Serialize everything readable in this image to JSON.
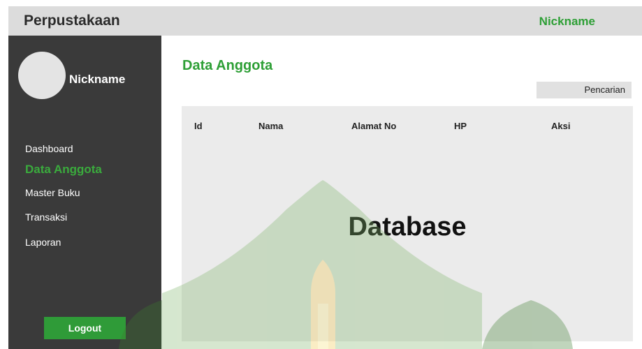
{
  "app": {
    "title": "Perpustakaan",
    "nickname_top": "Nickname"
  },
  "sidebar": {
    "nickname": "Nickname",
    "items": [
      {
        "label": "Dashboard",
        "active": false
      },
      {
        "label": "Data Anggota",
        "active": true
      },
      {
        "label": "Master Buku",
        "active": false
      },
      {
        "label": "Transaksi",
        "active": false
      },
      {
        "label": "Laporan",
        "active": false
      }
    ],
    "logout_label": "Logout"
  },
  "main": {
    "title": "Data Anggota",
    "search_label": "Pencarian",
    "table": {
      "columns": [
        "Id",
        "Nama",
        "Alamat No",
        "HP",
        "Aksi"
      ]
    },
    "placeholder_text": "Database"
  },
  "colors": {
    "accent_green": "#2e9f36",
    "sidebar_bg": "#3a3a3a",
    "topbar_bg": "#dcdcdc",
    "panel_bg": "#ebebeb"
  },
  "icons": {
    "avatar": "avatar-placeholder-circle"
  }
}
